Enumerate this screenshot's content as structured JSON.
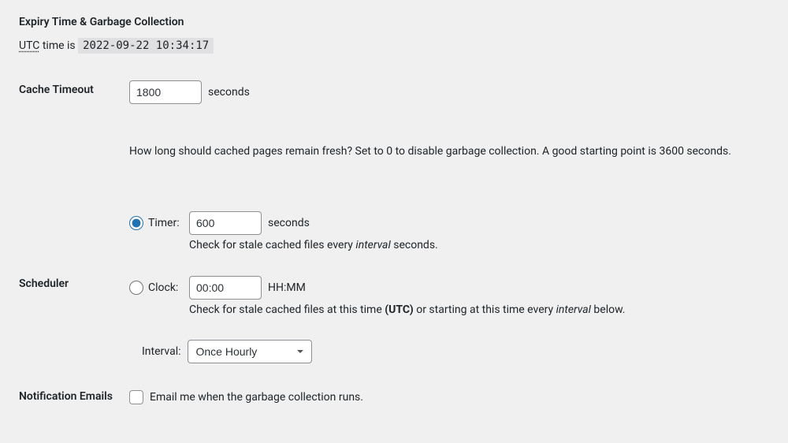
{
  "section_title": "Expiry Time & Garbage Collection",
  "utc": {
    "abbr": "UTC",
    "time_is": " time is ",
    "timestamp": "2022-09-22 10:34:17"
  },
  "cache_timeout": {
    "label": "Cache Timeout",
    "value": "1800",
    "unit": "seconds",
    "help": "How long should cached pages remain fresh? Set to 0 to disable garbage collection. A good starting point is 3600 seconds."
  },
  "scheduler": {
    "label": "Scheduler",
    "timer": {
      "label": "Timer:",
      "value": "600",
      "unit": "seconds",
      "desc_prefix": "Check for stale cached files every ",
      "desc_em": "interval",
      "desc_suffix": " seconds.",
      "checked": true
    },
    "clock": {
      "label": "Clock:",
      "value": "00:00",
      "unit": "HH:MM",
      "desc_prefix": "Check for stale cached files at this time ",
      "desc_strong": "(UTC)",
      "desc_mid": " or starting at this time every ",
      "desc_em": "interval",
      "desc_suffix": " below.",
      "checked": false
    },
    "interval": {
      "label": "Interval:",
      "selected": "Once Hourly"
    }
  },
  "notification": {
    "label": "Notification Emails",
    "checkbox_label": "Email me when the garbage collection runs.",
    "checked": false
  }
}
